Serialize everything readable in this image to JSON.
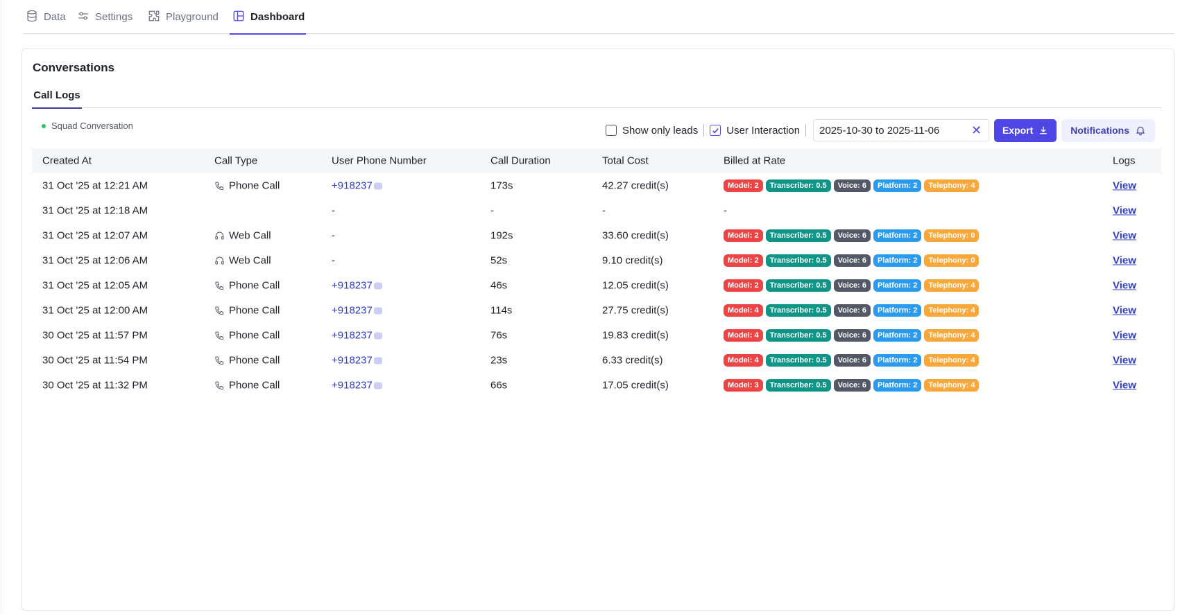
{
  "nav": {
    "tabs": [
      {
        "label": "Data",
        "icon": "database-icon"
      },
      {
        "label": "Settings",
        "icon": "sliders-icon"
      },
      {
        "label": "Playground",
        "icon": "puzzle-icon"
      },
      {
        "label": "Dashboard",
        "icon": "layout-icon",
        "active": true
      }
    ]
  },
  "card": {
    "title": "Conversations",
    "subtab": "Call Logs"
  },
  "toolbar": {
    "squad_label": "Squad Conversation",
    "show_only_leads_label": "Show only leads",
    "show_only_leads_checked": false,
    "user_interaction_label": "User Interaction",
    "user_interaction_checked": true,
    "date_range": "2025-10-30 to 2025-11-06",
    "export_label": "Export",
    "notifications_label": "Notifications"
  },
  "table": {
    "headers": {
      "created_at": "Created At",
      "call_type": "Call Type",
      "phone": "User Phone Number",
      "duration": "Call Duration",
      "cost": "Total Cost",
      "rate": "Billed at Rate",
      "logs": "Logs"
    },
    "rows": [
      {
        "created_at": "31 Oct '25 at 12:21 AM",
        "call_type": "Phone Call",
        "type_icon": "phone-icon",
        "phone": "+918237",
        "duration": "173s",
        "cost": "42.27 credit(s)",
        "rate": {
          "model": "Model: 2",
          "transcriber": "Transcriber: 0.5",
          "voice": "Voice: 6",
          "platform": "Platform: 2",
          "telephony": "Telephony: 4"
        },
        "logs": "View"
      },
      {
        "created_at": "31 Oct '25 at 12:18 AM",
        "call_type": "",
        "type_icon": "",
        "phone": "-",
        "duration": "-",
        "cost": "-",
        "rate_text": "-",
        "logs": "View"
      },
      {
        "created_at": "31 Oct '25 at 12:07 AM",
        "call_type": "Web Call",
        "type_icon": "headset-icon",
        "phone": "-",
        "duration": "192s",
        "cost": "33.60 credit(s)",
        "rate": {
          "model": "Model: 2",
          "transcriber": "Transcriber: 0.5",
          "voice": "Voice: 6",
          "platform": "Platform: 2",
          "telephony": "Telephony: 0"
        },
        "logs": "View"
      },
      {
        "created_at": "31 Oct '25 at 12:06 AM",
        "call_type": "Web Call",
        "type_icon": "headset-icon",
        "phone": "-",
        "duration": "52s",
        "cost": "9.10 credit(s)",
        "rate": {
          "model": "Model: 2",
          "transcriber": "Transcriber: 0.5",
          "voice": "Voice: 6",
          "platform": "Platform: 2",
          "telephony": "Telephony: 0"
        },
        "logs": "View"
      },
      {
        "created_at": "31 Oct '25 at 12:05 AM",
        "call_type": "Phone Call",
        "type_icon": "phone-icon",
        "phone": "+918237",
        "duration": "46s",
        "cost": "12.05 credit(s)",
        "rate": {
          "model": "Model: 2",
          "transcriber": "Transcriber: 0.5",
          "voice": "Voice: 6",
          "platform": "Platform: 2",
          "telephony": "Telephony: 4"
        },
        "logs": "View"
      },
      {
        "created_at": "31 Oct '25 at 12:00 AM",
        "call_type": "Phone Call",
        "type_icon": "phone-icon",
        "phone": "+918237",
        "duration": "114s",
        "cost": "27.75 credit(s)",
        "rate": {
          "model": "Model: 4",
          "transcriber": "Transcriber: 0.5",
          "voice": "Voice: 6",
          "platform": "Platform: 2",
          "telephony": "Telephony: 4"
        },
        "logs": "View"
      },
      {
        "created_at": "30 Oct '25 at 11:57 PM",
        "call_type": "Phone Call",
        "type_icon": "phone-icon",
        "phone": "+918237",
        "duration": "76s",
        "cost": "19.83 credit(s)",
        "rate": {
          "model": "Model: 4",
          "transcriber": "Transcriber: 0.5",
          "voice": "Voice: 6",
          "platform": "Platform: 2",
          "telephony": "Telephony: 4"
        },
        "logs": "View"
      },
      {
        "created_at": "30 Oct '25 at 11:54 PM",
        "call_type": "Phone Call",
        "type_icon": "phone-icon",
        "phone": "+918237",
        "duration": "23s",
        "cost": "6.33 credit(s)",
        "rate": {
          "model": "Model: 4",
          "transcriber": "Transcriber: 0.5",
          "voice": "Voice: 6",
          "platform": "Platform: 2",
          "telephony": "Telephony: 4"
        },
        "logs": "View"
      },
      {
        "created_at": "30 Oct '25 at 11:32 PM",
        "call_type": "Phone Call",
        "type_icon": "phone-icon",
        "phone": "+918237",
        "duration": "66s",
        "cost": "17.05 credit(s)",
        "rate": {
          "model": "Model: 3",
          "transcriber": "Transcriber: 0.5",
          "voice": "Voice: 6",
          "platform": "Platform: 2",
          "telephony": "Telephony: 4"
        },
        "logs": "View"
      }
    ]
  }
}
